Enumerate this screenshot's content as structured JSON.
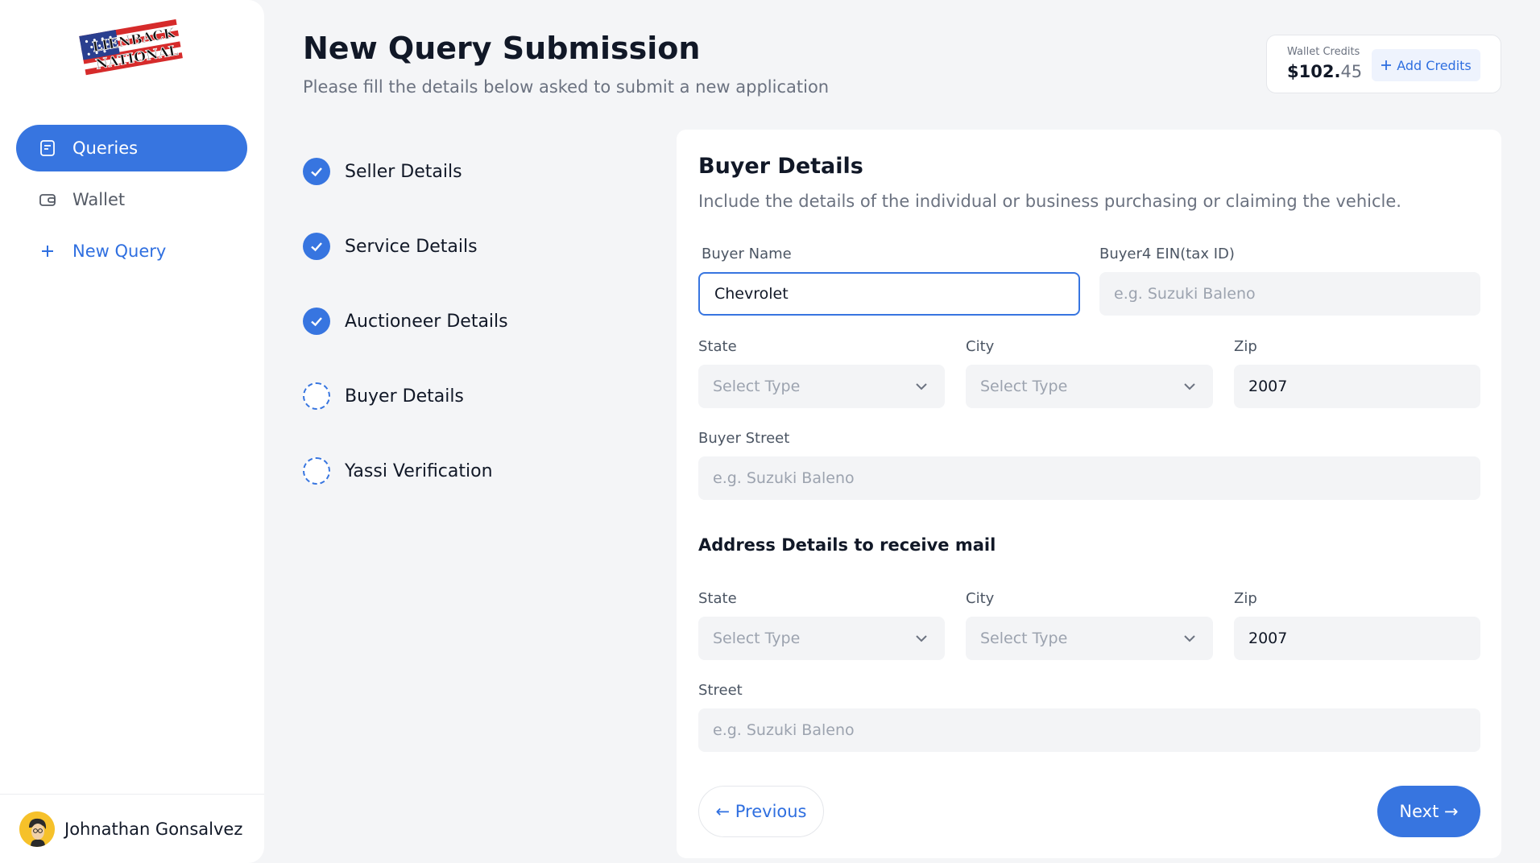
{
  "brand": {
    "logo_text_line1": "LIENBACK",
    "logo_text_line2": "NATIONAL"
  },
  "sidebar": {
    "items": [
      {
        "label": "Queries",
        "icon": "document-icon",
        "active": true
      },
      {
        "label": "Wallet",
        "icon": "wallet-icon",
        "active": false
      },
      {
        "label": "New Query",
        "icon": "plus-icon",
        "active": false
      }
    ],
    "user": {
      "name": "Johnathan Gonsalvez"
    }
  },
  "header": {
    "title": "New Query Submission",
    "subtitle": "Please fill the details below asked to submit a new application"
  },
  "wallet": {
    "label": "Wallet Credits",
    "amount_main": "$102.",
    "amount_cents": "45",
    "add_label": "Add Credits"
  },
  "steps": [
    {
      "label": "Seller Details",
      "status": "done"
    },
    {
      "label": "Service Details",
      "status": "done"
    },
    {
      "label": "Auctioneer Details",
      "status": "done"
    },
    {
      "label": "Buyer Details",
      "status": "current"
    },
    {
      "label": "Yassi Verification",
      "status": "pending"
    }
  ],
  "form": {
    "title": "Buyer Details",
    "subtitle": "Include the details of the individual or business purchasing or claiming the vehicle.",
    "buyer_name": {
      "label": "Buyer Name",
      "value": "Chevrolet"
    },
    "buyer_ein": {
      "label": "Buyer4 EIN(tax ID)",
      "placeholder": "e.g. Suzuki Baleno"
    },
    "state1": {
      "label": "State",
      "placeholder": "Select Type"
    },
    "city1": {
      "label": "City",
      "placeholder": "Select Type"
    },
    "zip1": {
      "label": "Zip",
      "value": "2007"
    },
    "buyer_street": {
      "label": "Buyer Street",
      "placeholder": "e.g. Suzuki Baleno"
    },
    "mail_section_title": "Address Details to receive mail",
    "state2": {
      "label": "State",
      "placeholder": "Select Type"
    },
    "city2": {
      "label": "City",
      "placeholder": "Select Type"
    },
    "zip2": {
      "label": "Zip",
      "value": "2007"
    },
    "street": {
      "label": "Street",
      "placeholder": "e.g. Suzuki Baleno"
    },
    "prev_label": "← Previous",
    "next_label": "Next →"
  },
  "colors": {
    "accent": "#3775e0",
    "background": "#f4f5f7"
  }
}
